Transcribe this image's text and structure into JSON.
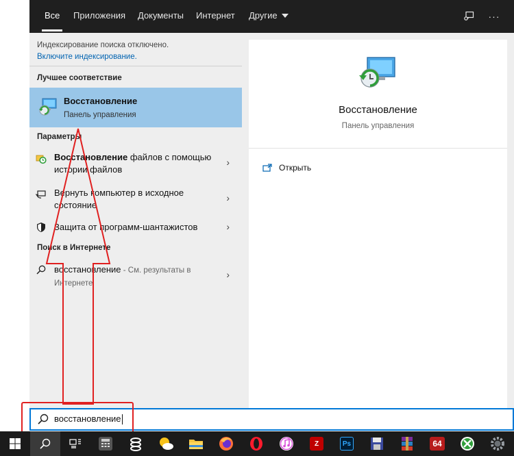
{
  "tabs": [
    {
      "label": "Все"
    },
    {
      "label": "Приложения"
    },
    {
      "label": "Документы"
    },
    {
      "label": "Интернет"
    },
    {
      "label": "Другие"
    }
  ],
  "toolbar": {
    "more_glyph": "···"
  },
  "index_notice": {
    "text": "Индексирование поиска отключено.",
    "link": "Включите индексирование."
  },
  "best_match": {
    "heading": "Лучшее соответствие",
    "title": "Восстановление",
    "subtitle": "Панель управления"
  },
  "settings": {
    "heading": "Параметры",
    "items": [
      {
        "bold": "Восстановление",
        "rest": " файлов с помощью истории файлов"
      },
      {
        "bold": "",
        "rest": "Вернуть компьютер в исходное состояние"
      },
      {
        "bold": "",
        "rest": "Защита от программ-шантажистов"
      }
    ]
  },
  "web": {
    "heading": "Поиск в Интернете",
    "query": "восстановление",
    "suffix": " - См. результаты в Интернете"
  },
  "preview": {
    "title": "Восстановление",
    "subtitle": "Панель управления",
    "open_label": "Открыть"
  },
  "search": {
    "value": "восстановление"
  },
  "taskbar": {
    "apps": [
      {
        "name": "calculator"
      },
      {
        "name": "steam"
      },
      {
        "name": "weather"
      },
      {
        "name": "explorer"
      },
      {
        "name": "firefox"
      },
      {
        "name": "opera"
      },
      {
        "name": "itunes"
      },
      {
        "name": "filezilla",
        "label": "Z"
      },
      {
        "name": "photoshop",
        "label": "Ps"
      },
      {
        "name": "save"
      },
      {
        "name": "winrar"
      },
      {
        "name": "aida64",
        "label": "64"
      },
      {
        "name": "xbox"
      },
      {
        "name": "gear"
      }
    ]
  },
  "colors": {
    "accent": "#0078d7",
    "highlight": "#99c6e8",
    "annotation": "#e02020"
  }
}
